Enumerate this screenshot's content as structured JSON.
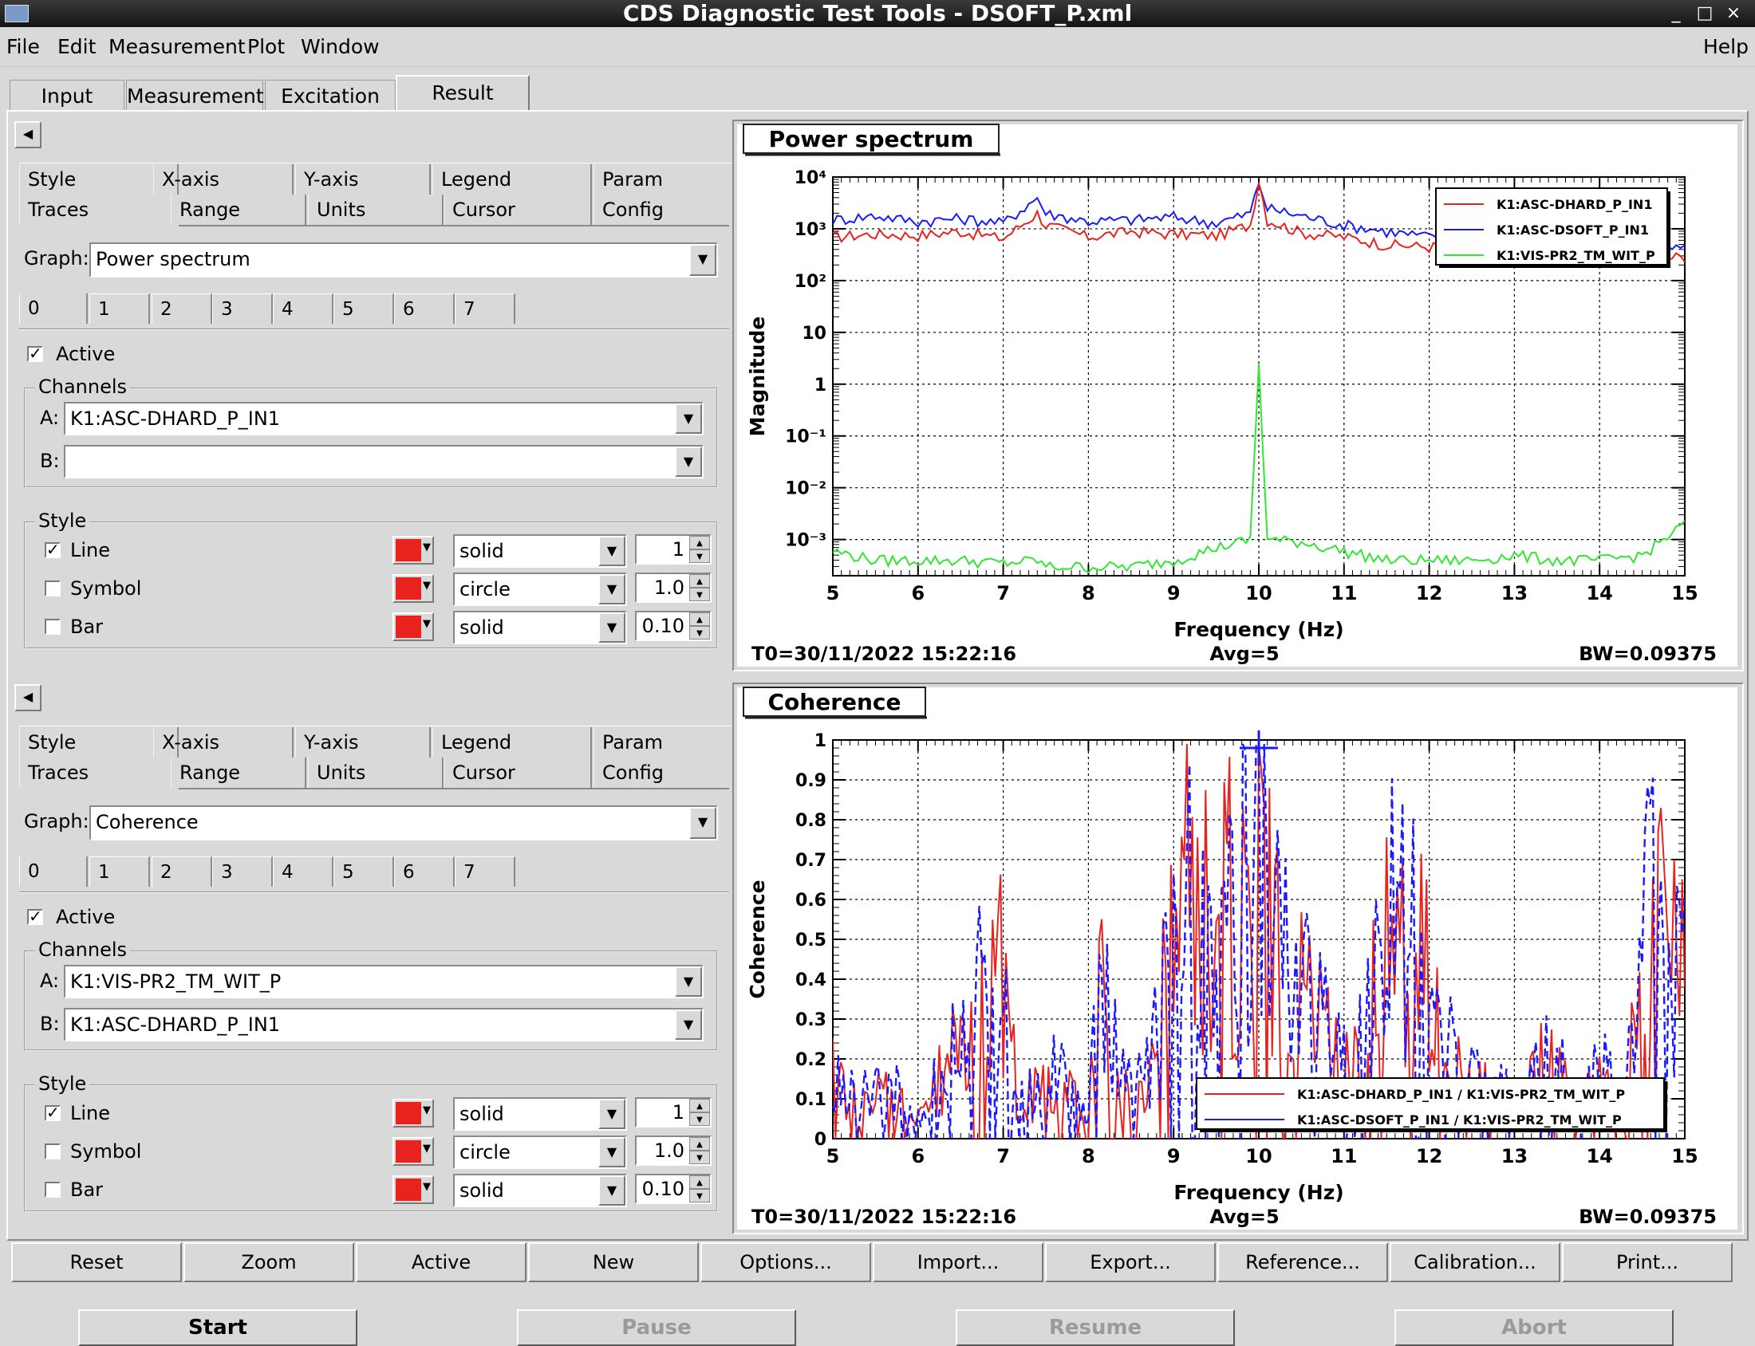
{
  "window": {
    "title": "CDS Diagnostic Test Tools - DSOFT_P.xml",
    "controls": [
      "_",
      "□",
      "×"
    ]
  },
  "menubar": {
    "items": [
      "File",
      "Edit",
      "Measurement",
      "Plot",
      "Window"
    ],
    "help": "Help"
  },
  "main_tabs": [
    "Input",
    "Measurement",
    "Excitation",
    "Result"
  ],
  "selected_main_tab": "Result",
  "panels": [
    {
      "subtabs_row1": [
        "Style",
        "X-axis",
        "Y-axis",
        "Legend",
        "Param"
      ],
      "subtabs_row2": [
        "Traces",
        "Range",
        "Units",
        "Cursor",
        "Config"
      ],
      "graph_label": "Graph:",
      "graph_value": "Power spectrum",
      "trace_tabs": [
        "0",
        "1",
        "2",
        "3",
        "4",
        "5",
        "6",
        "7"
      ],
      "active_label": "Active",
      "channels_title": "Channels",
      "channel_a_label": "A:",
      "channel_a": "K1:ASC-DHARD_P_IN1",
      "channel_b_label": "B:",
      "channel_b": "",
      "style_title": "Style",
      "style_rows": [
        {
          "label": "Line",
          "checked": true,
          "color": "#e8231e",
          "type": "solid",
          "size": "1"
        },
        {
          "label": "Symbol",
          "checked": false,
          "color": "#e8231e",
          "type": "circle",
          "size": "1.0"
        },
        {
          "label": "Bar",
          "checked": false,
          "color": "#e8231e",
          "type": "solid",
          "size": "0.10"
        }
      ]
    },
    {
      "subtabs_row1": [
        "Style",
        "X-axis",
        "Y-axis",
        "Legend",
        "Param"
      ],
      "subtabs_row2": [
        "Traces",
        "Range",
        "Units",
        "Cursor",
        "Config"
      ],
      "graph_label": "Graph:",
      "graph_value": "Coherence",
      "trace_tabs": [
        "0",
        "1",
        "2",
        "3",
        "4",
        "5",
        "6",
        "7"
      ],
      "active_label": "Active",
      "channels_title": "Channels",
      "channel_a_label": "A:",
      "channel_a": "K1:VIS-PR2_TM_WIT_P",
      "channel_b_label": "B:",
      "channel_b": "K1:ASC-DHARD_P_IN1",
      "style_title": "Style",
      "style_rows": [
        {
          "label": "Line",
          "checked": true,
          "color": "#e8231e",
          "type": "solid",
          "size": "1"
        },
        {
          "label": "Symbol",
          "checked": false,
          "color": "#e8231e",
          "type": "circle",
          "size": "1.0"
        },
        {
          "label": "Bar",
          "checked": false,
          "color": "#e8231e",
          "type": "solid",
          "size": "0.10"
        }
      ]
    }
  ],
  "plots": [
    {
      "title": "Power spectrum",
      "t0": "T0=30/11/2022 15:22:16",
      "avg": "Avg=5",
      "bw": "BW=0.09375",
      "xlabel": "Frequency (Hz)",
      "ylabel": "Magnitude",
      "xticks": [
        "5",
        "6",
        "7",
        "8",
        "9",
        "10",
        "11",
        "12",
        "13",
        "14",
        "15"
      ],
      "yticks": [
        "10⁻³",
        "10⁻²",
        "10⁻¹",
        "1",
        "10",
        "10²",
        "10³",
        "10⁴"
      ],
      "legend": [
        "K1:ASC-DHARD_P_IN1",
        "K1:ASC-DSOFT_P_IN1",
        "K1:VIS-PR2_TM_WIT_P"
      ]
    },
    {
      "title": "Coherence",
      "t0": "T0=30/11/2022 15:22:16",
      "avg": "Avg=5",
      "bw": "BW=0.09375",
      "xlabel": "Frequency (Hz)",
      "ylabel": "Coherence",
      "xticks": [
        "5",
        "6",
        "7",
        "8",
        "9",
        "10",
        "11",
        "12",
        "13",
        "14",
        "15"
      ],
      "yticks": [
        "0",
        "0.1",
        "0.2",
        "0.3",
        "0.4",
        "0.5",
        "0.6",
        "0.7",
        "0.8",
        "0.9",
        "1"
      ],
      "legend": [
        "K1:ASC-DHARD_P_IN1 / K1:VIS-PR2_TM_WIT_P",
        "K1:ASC-DSOFT_P_IN1 / K1:VIS-PR2_TM_WIT_P"
      ]
    }
  ],
  "colors": {
    "red": "#e8231e",
    "blue": "#1a1aff",
    "green": "#33e633"
  },
  "chart_data": [
    {
      "type": "line",
      "title": "Power spectrum",
      "xlabel": "Frequency (Hz)",
      "ylabel": "Magnitude",
      "xlim": [
        5,
        15
      ],
      "ylim": [
        0.0002,
        10000
      ],
      "yscale": "log",
      "grid": true,
      "legend_position": "top-right",
      "x": [
        5,
        5.5,
        6,
        6.5,
        7,
        7.4,
        7.5,
        8,
        8.5,
        9,
        9.5,
        9.9,
        10,
        10.1,
        10.5,
        11,
        11.5,
        12,
        12.5,
        13,
        13.5,
        14,
        14.5,
        15
      ],
      "series": [
        {
          "name": "K1:ASC-DHARD_P_IN1",
          "values": [
            700,
            800,
            750,
            900,
            650,
            2000,
            1200,
            700,
            900,
            800,
            750,
            1200,
            9000,
            1500,
            850,
            700,
            500,
            450,
            500,
            300,
            250,
            300,
            250,
            300
          ]
        },
        {
          "name": "K1:ASC-DSOFT_P_IN1",
          "values": [
            1500,
            1800,
            1400,
            1600,
            1300,
            4000,
            2000,
            1400,
            1500,
            1700,
            1300,
            2000,
            8000,
            2500,
            1800,
            1200,
            900,
            700,
            800,
            600,
            500,
            500,
            450,
            400
          ]
        },
        {
          "name": "K1:VIS-PR2_TM_WIT_P",
          "values": [
            0.0006,
            0.0004,
            0.0004,
            0.0004,
            0.00035,
            0.0004,
            0.0003,
            0.0003,
            0.0003,
            0.0004,
            0.0007,
            0.001,
            2.5,
            0.001,
            0.0009,
            0.0006,
            0.0004,
            0.0004,
            0.0004,
            0.0005,
            0.0004,
            0.0004,
            0.0005,
            0.002
          ]
        }
      ]
    },
    {
      "type": "line",
      "title": "Coherence",
      "xlabel": "Frequency (Hz)",
      "ylabel": "Coherence",
      "xlim": [
        5,
        15
      ],
      "ylim": [
        0,
        1
      ],
      "grid": true,
      "legend_position": "bottom-right",
      "x": [
        5,
        5.3,
        5.7,
        6,
        6.5,
        6.9,
        7.2,
        7.6,
        8,
        8.1,
        8.5,
        8.8,
        9,
        9.5,
        9.8,
        10,
        10.2,
        10.4,
        10.6,
        11,
        11.3,
        11.6,
        11.9,
        12.2,
        12.6,
        13,
        13.4,
        13.7,
        14,
        14.3,
        14.6,
        15
      ],
      "series": [
        {
          "name": "K1:ASC-DHARD_P_IN1 / K1:VIS-PR2_TM_WIT_P",
          "values": [
            0.2,
            0.1,
            0.15,
            0.05,
            0.3,
            0.62,
            0.1,
            0.2,
            0.05,
            0.48,
            0.1,
            0.3,
            0.78,
            0.7,
            0.72,
            0.97,
            0.55,
            0.5,
            0.45,
            0.2,
            0.35,
            0.8,
            0.55,
            0.3,
            0.15,
            0.1,
            0.25,
            0.1,
            0.2,
            0.1,
            0.72,
            0.5
          ]
        },
        {
          "name": "K1:ASC-DSOFT_P_IN1 / K1:VIS-PR2_TM_WIT_P",
          "values": [
            0.2,
            0.12,
            0.17,
            0.06,
            0.3,
            0.6,
            0.12,
            0.22,
            0.06,
            0.5,
            0.12,
            0.3,
            0.7,
            0.72,
            0.73,
            0.98,
            0.58,
            0.52,
            0.47,
            0.22,
            0.35,
            0.77,
            0.57,
            0.32,
            0.17,
            0.12,
            0.27,
            0.12,
            0.22,
            0.12,
            0.74,
            0.55
          ]
        }
      ]
    }
  ],
  "bottom_buttons": [
    "Reset",
    "Zoom",
    "Active",
    "New",
    "Options...",
    "Import...",
    "Export...",
    "Reference...",
    "Calibration...",
    "Print..."
  ],
  "run_buttons": [
    {
      "label": "Start",
      "enabled": true
    },
    {
      "label": "Pause",
      "enabled": false
    },
    {
      "label": "Resume",
      "enabled": false
    },
    {
      "label": "Abort",
      "enabled": false
    }
  ]
}
